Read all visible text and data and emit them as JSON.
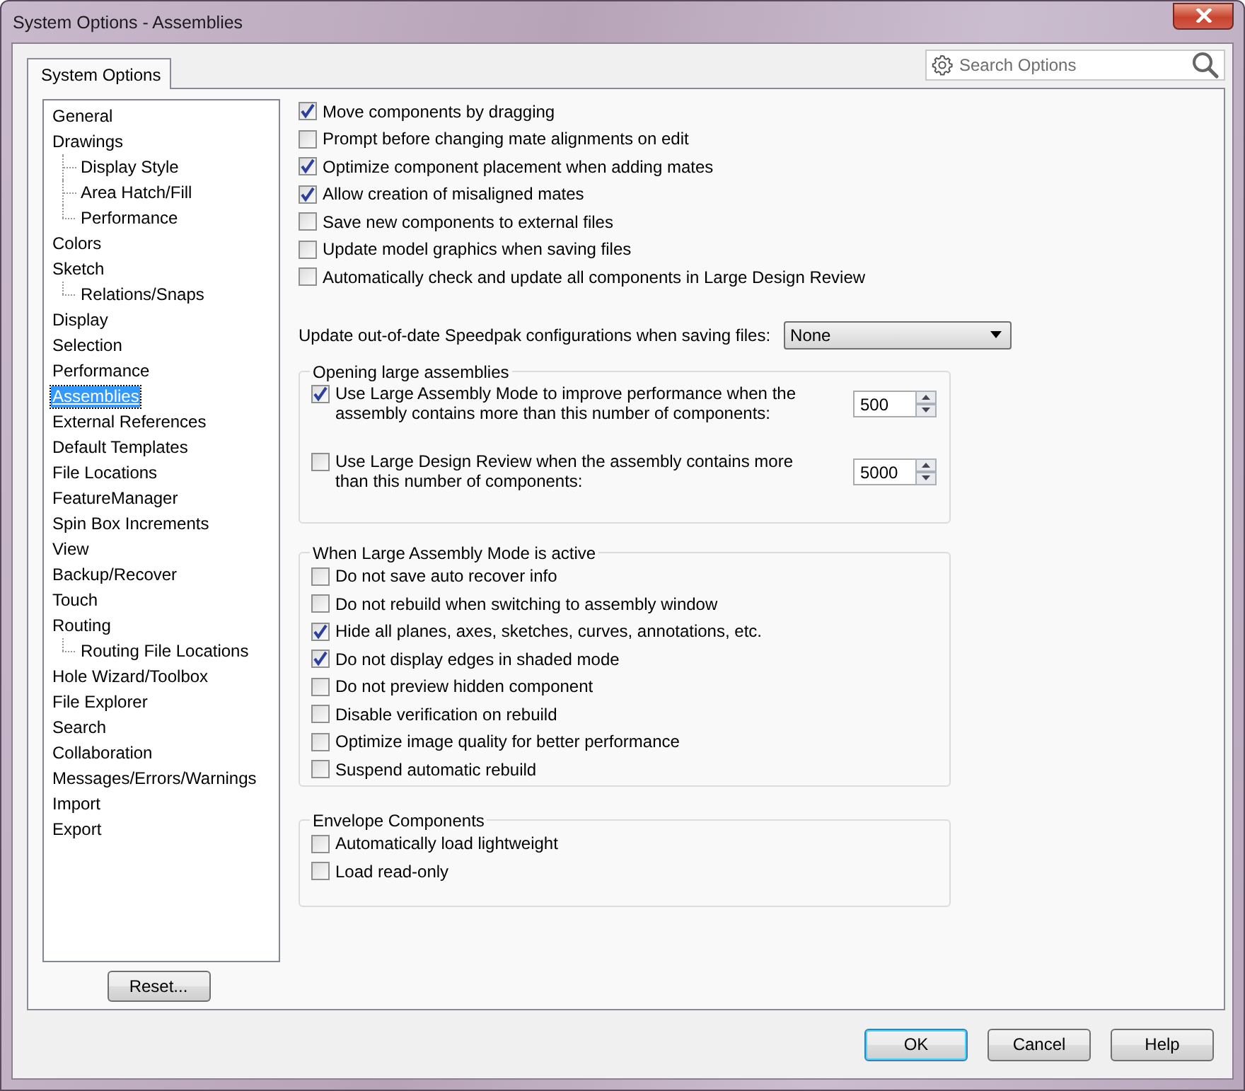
{
  "window": {
    "title": "System Options - Assemblies"
  },
  "tabs": [
    {
      "label": "System Options",
      "selected": true
    }
  ],
  "search": {
    "placeholder": "Search Options"
  },
  "sidebar": {
    "items": [
      {
        "label": "General",
        "selected": false
      },
      {
        "label": "Drawings",
        "selected": false,
        "children": [
          {
            "label": "Display Style",
            "selected": false
          },
          {
            "label": "Area Hatch/Fill",
            "selected": false
          },
          {
            "label": "Performance",
            "selected": false
          }
        ]
      },
      {
        "label": "Colors",
        "selected": false
      },
      {
        "label": "Sketch",
        "selected": false,
        "children": [
          {
            "label": "Relations/Snaps",
            "selected": false
          }
        ]
      },
      {
        "label": "Display",
        "selected": false
      },
      {
        "label": "Selection",
        "selected": false
      },
      {
        "label": "Performance",
        "selected": false
      },
      {
        "label": "Assemblies",
        "selected": true
      },
      {
        "label": "External References",
        "selected": false
      },
      {
        "label": "Default Templates",
        "selected": false
      },
      {
        "label": "File Locations",
        "selected": false
      },
      {
        "label": "FeatureManager",
        "selected": false
      },
      {
        "label": "Spin Box Increments",
        "selected": false
      },
      {
        "label": "View",
        "selected": false
      },
      {
        "label": "Backup/Recover",
        "selected": false
      },
      {
        "label": "Touch",
        "selected": false
      },
      {
        "label": "Routing",
        "selected": false,
        "children": [
          {
            "label": "Routing File Locations",
            "selected": false
          }
        ]
      },
      {
        "label": "Hole Wizard/Toolbox",
        "selected": false
      },
      {
        "label": "File Explorer",
        "selected": false
      },
      {
        "label": "Search",
        "selected": false
      },
      {
        "label": "Collaboration",
        "selected": false
      },
      {
        "label": "Messages/Errors/Warnings",
        "selected": false
      },
      {
        "label": "Import",
        "selected": false
      },
      {
        "label": "Export",
        "selected": false
      }
    ],
    "reset_button": "Reset..."
  },
  "options": [
    {
      "label": "Move components by dragging",
      "checked": true
    },
    {
      "label": "Prompt before changing mate alignments on edit",
      "checked": false
    },
    {
      "label": "Optimize component placement when adding mates",
      "checked": true
    },
    {
      "label": "Allow creation of misaligned mates",
      "checked": true
    },
    {
      "label": "Save new components to external files",
      "checked": false
    },
    {
      "label": "Update model graphics when saving files",
      "checked": false
    },
    {
      "label": "Automatically check and update all components in Large Design Review",
      "checked": false
    }
  ],
  "speedpak": {
    "label": "Update out-of-date Speedpak configurations when saving files:",
    "value": "None"
  },
  "groups": [
    {
      "title": "Opening large assemblies",
      "kind": "threshold",
      "items": [
        {
          "label": "Use Large Assembly Mode to improve performance when the assembly contains more than this number of components:",
          "checked": true,
          "value": "500"
        },
        {
          "label": "Use Large Design Review when the assembly contains more than this number of components:",
          "checked": false,
          "value": "5000"
        }
      ]
    },
    {
      "title": "When Large Assembly Mode is active",
      "kind": "list",
      "items": [
        {
          "label": "Do not save auto recover info",
          "checked": false
        },
        {
          "label": "Do not rebuild when switching to assembly window",
          "checked": false
        },
        {
          "label": "Hide all planes, axes, sketches, curves, annotations, etc.",
          "checked": true
        },
        {
          "label": "Do not display edges in shaded mode",
          "checked": true
        },
        {
          "label": "Do not preview hidden component",
          "checked": false
        },
        {
          "label": "Disable verification on rebuild",
          "checked": false
        },
        {
          "label": "Optimize image quality for better performance",
          "checked": false
        },
        {
          "label": "Suspend automatic rebuild",
          "checked": false
        }
      ]
    },
    {
      "title": "Envelope Components",
      "kind": "list",
      "items": [
        {
          "label": "Automatically load lightweight",
          "checked": false
        },
        {
          "label": "Load read-only",
          "checked": false
        }
      ]
    }
  ],
  "buttons": [
    {
      "label": "OK",
      "default": true
    },
    {
      "label": "Cancel",
      "default": false
    },
    {
      "label": "Help",
      "default": false
    }
  ]
}
